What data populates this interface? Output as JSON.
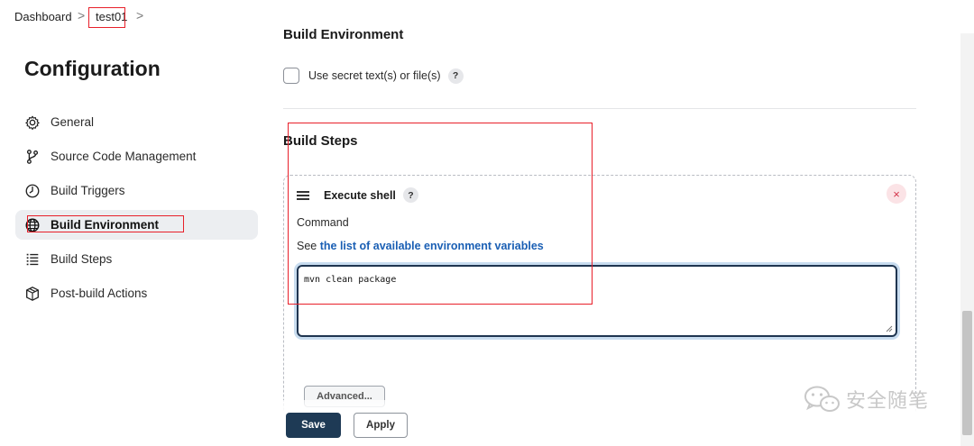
{
  "breadcrumb": {
    "items": [
      "Dashboard",
      "test01"
    ],
    "separator": ">"
  },
  "sidebar": {
    "title": "Configuration",
    "items": [
      {
        "label": "General",
        "icon": "gear-icon"
      },
      {
        "label": "Source Code Management",
        "icon": "branch-icon"
      },
      {
        "label": "Build Triggers",
        "icon": "clock-icon"
      },
      {
        "label": "Build Environment",
        "icon": "globe-icon",
        "active": true
      },
      {
        "label": "Build Steps",
        "icon": "list-icon"
      },
      {
        "label": "Post-build Actions",
        "icon": "package-icon"
      }
    ]
  },
  "main": {
    "build_environment_title": "Build Environment",
    "secret_checkbox_label": "Use secret text(s) or file(s)",
    "help_symbol": "?",
    "build_steps_title": "Build Steps",
    "step": {
      "title": "Execute shell",
      "close_symbol": "×",
      "command_label": "Command",
      "see_prefix": "See",
      "env_link_text": "the list of available environment variables",
      "command_value": "mvn clean package",
      "advanced_label": "Advanced..."
    }
  },
  "footer": {
    "save_label": "Save",
    "apply_label": "Apply"
  },
  "watermark": {
    "text": "安全随笔"
  },
  "colors": {
    "primary": "#1e3a55",
    "link": "#1a5fb4",
    "highlight_box": "#e8202a",
    "active_nav_bg": "#eceef1"
  }
}
